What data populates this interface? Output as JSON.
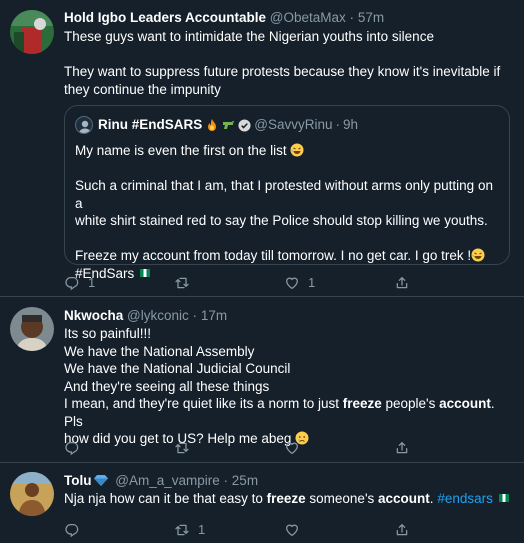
{
  "tweets": [
    {
      "name": "Hold Igbo Leaders Accountable",
      "handle": "@ObetaMax",
      "time": "57m",
      "lines": [
        "These guys want to intimidate the Nigerian youths into silence",
        "",
        "They want to suppress future protests because they know it's inevitable if",
        "they continue the impunity"
      ],
      "quote": {
        "name": "Rinu #EndSARS",
        "handle": "@SavvyRinu",
        "time": "9h",
        "line1": "My name is even the first on the list",
        "line2": "Such a criminal that I am, that I protested without arms only putting on a",
        "line3": "white shirt stained red to say the Police should stop killing we youths.",
        "line4": "Freeze my account from today till tomorrow. I no get car. I go trek !",
        "line5": "#EndSars"
      },
      "actions": {
        "replies": "1",
        "retweets": "",
        "likes": "1"
      }
    },
    {
      "name": "Nkwocha",
      "handle": "@lykconic",
      "time": "17m",
      "lines": [
        "Its so painful!!!",
        "We have the National Assembly",
        "We have the National Judicial Council",
        "And they're seeing all these things"
      ],
      "line5_a": "I mean, and they're quiet like its a norm to just ",
      "line5_b": "freeze",
      "line5_c": " people's ",
      "line5_d": "account",
      "line5_e": ". Pls",
      "line6": "how did you get to US? Help me abeg",
      "actions": {
        "replies": "",
        "retweets": "",
        "likes": ""
      }
    },
    {
      "name": "Tolu",
      "handle": "@Am_a_vampire",
      "time": "25m",
      "text_a": "Nja nja how can it be that easy to ",
      "text_b": "freeze",
      "text_c": " someone's ",
      "text_d": "account",
      "text_e": ". ",
      "hashtag": "#endsars",
      "actions": {
        "replies": "",
        "retweets": "1",
        "likes": ""
      }
    }
  ],
  "dot": "·",
  "icons": [
    "reply-icon",
    "retweet-icon",
    "like-icon",
    "share-icon",
    "verified-icon",
    "fire-emoji",
    "gun-emoji",
    "laughing-emoji",
    "nigeria-flag-emoji",
    "crying-emoji",
    "gem-emoji"
  ],
  "colors": {
    "background": "#15202b",
    "border": "#38444d",
    "muted": "#8899a6",
    "link": "#1da1f2"
  }
}
